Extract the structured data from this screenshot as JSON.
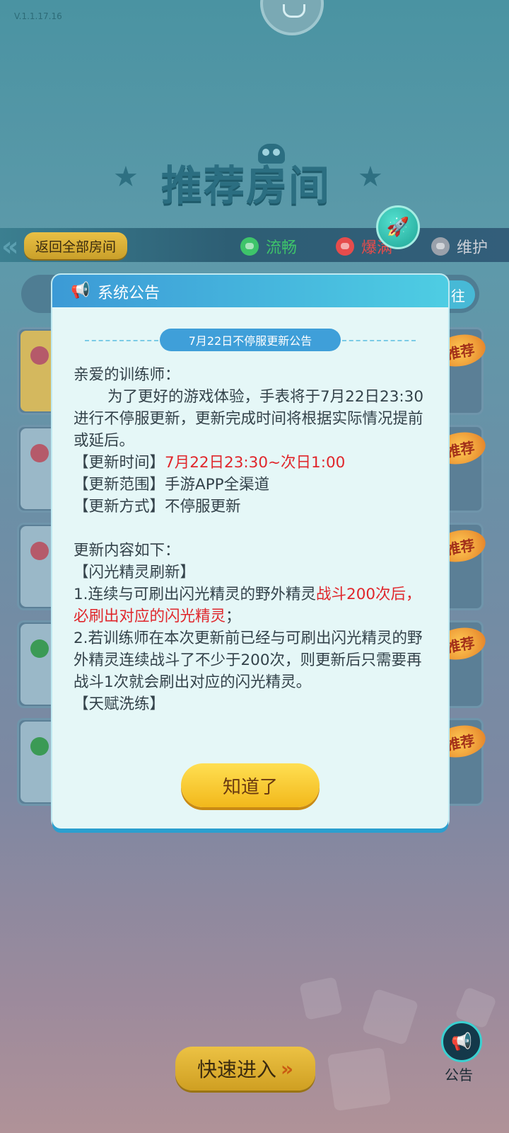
{
  "version": "V.1.1.17.16",
  "header": {
    "title": "推荐房间"
  },
  "filter_bar": {
    "back_label": "返回全部房间",
    "legend": [
      {
        "label": "流畅",
        "color": "#3ec46a"
      },
      {
        "label": "爆满",
        "color": "#e64c4c"
      },
      {
        "label": "维护",
        "color": "#9aa1ab"
      }
    ]
  },
  "tab_strip": {
    "right_partial": "往"
  },
  "room_cards": {
    "tag": "推荐"
  },
  "modal": {
    "title": "系统公告",
    "subtitle": "7月22日不停服更新公告",
    "lines": {
      "greeting": "亲爱的训练师：",
      "intro": "为了更好的游戏体验，手表将于7月22日23:30进行不停服更新，更新完成时间将根据实际情况提前或延后。",
      "time_label": "【更新时间】",
      "time_value": "7月22日23:30~次日1:00",
      "scope": "【更新范围】手游APP全渠道",
      "method": "【更新方式】不停服更新",
      "content_heading": "更新内容如下：",
      "section1": "【闪光精灵刷新】",
      "item1_a": "1.连续与可刷出闪光精灵的野外精灵",
      "item1_b": "战斗200次后，必刷出对应的闪光精灵",
      "item1_c": "；",
      "item2": "2.若训练师在本次更新前已经与可刷出闪光精灵的野外精灵连续战斗了不少于200次，则更新后只需要再战斗1次就会刷出对应的闪光精灵。",
      "section2": "【天赋洗练】"
    },
    "ok_button": "知道了"
  },
  "bottom": {
    "quick_enter": "快速进入",
    "quick_arrows": "»",
    "notice_label": "公告"
  }
}
